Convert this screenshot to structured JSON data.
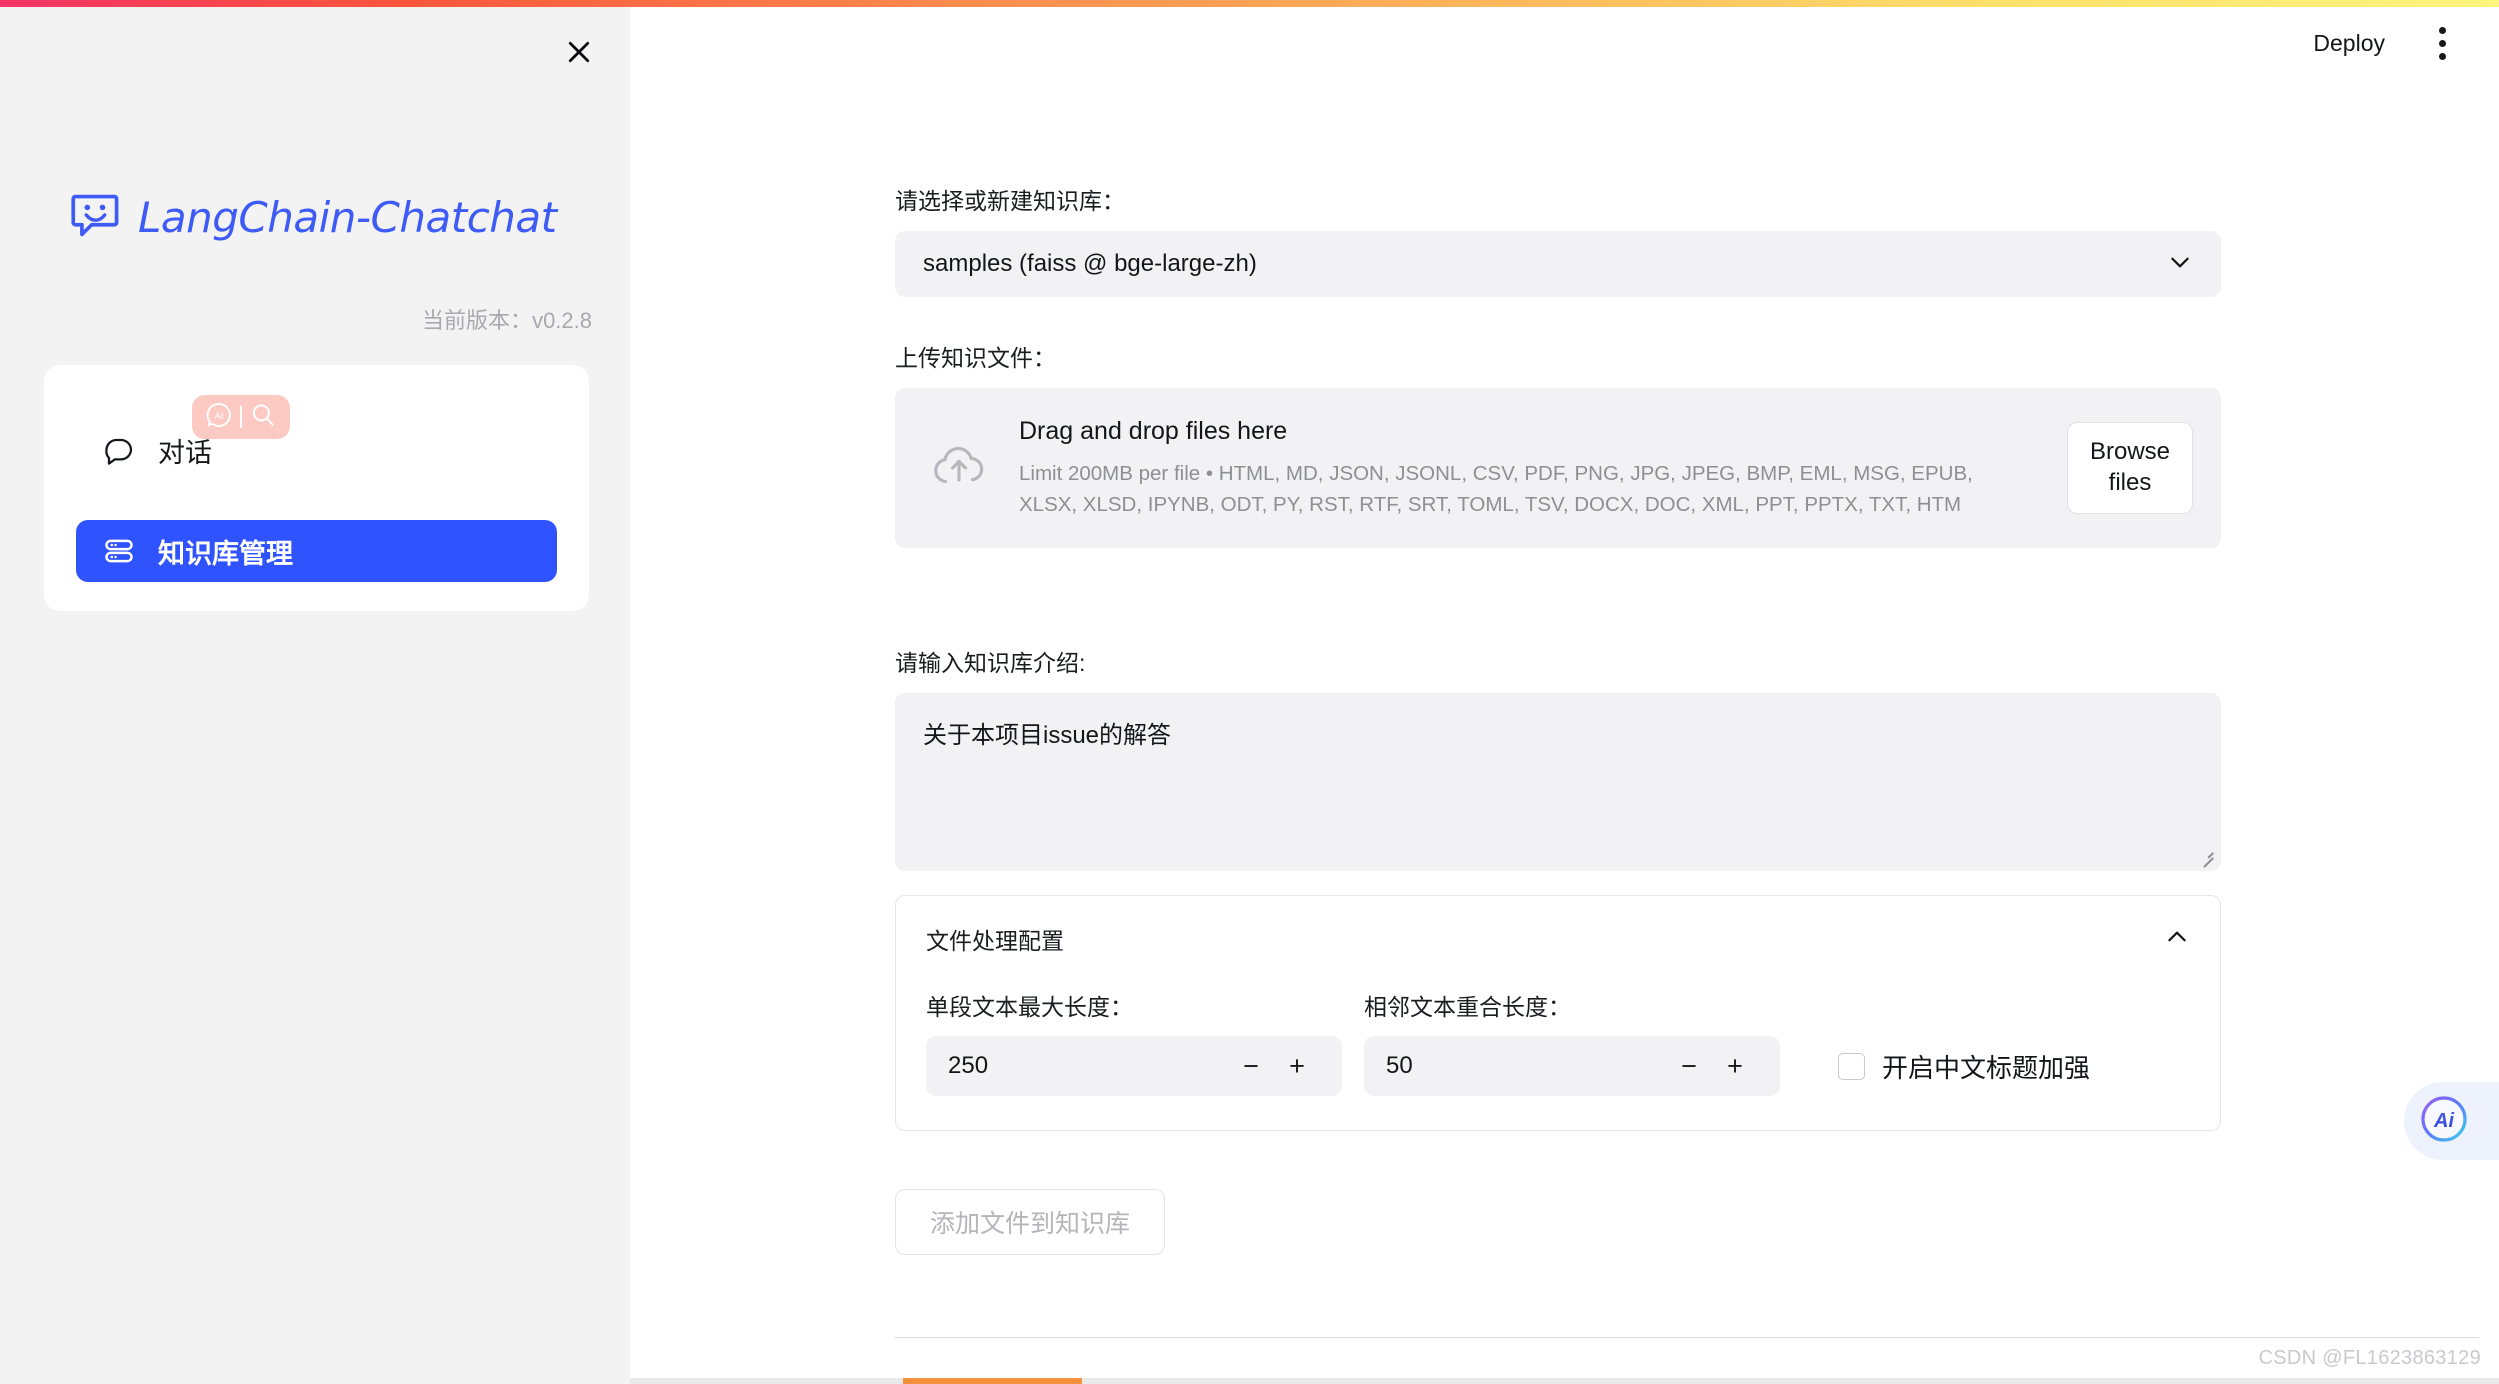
{
  "app": {
    "brand_name": "LangChain-Chatchat",
    "version_label": "当前版本：",
    "version_value": "v0.2.8"
  },
  "header": {
    "deploy_label": "Deploy",
    "menu_icon": "kebab-menu-icon"
  },
  "sidebar": {
    "close_icon": "close-icon",
    "items": [
      {
        "label": "对话",
        "icon": "chat-bubble-icon",
        "selected": false
      },
      {
        "label": "知识库管理",
        "icon": "database-icon",
        "selected": true
      }
    ],
    "badge": {
      "ai_icon": "ai-bubble-icon",
      "search_icon": "search-icon"
    }
  },
  "main": {
    "kb_select": {
      "label": "请选择或新建知识库：",
      "value": "samples (faiss @ bge-large-zh)",
      "chevron_icon": "chevron-down-icon"
    },
    "uploader": {
      "label": "上传知识文件：",
      "drag_title": "Drag and drop files here",
      "limit_text": "Limit 200MB per file • HTML, MD, JSON, JSONL, CSV, PDF, PNG, JPG, JPEG, BMP, EML, MSG, EPUB, XLSX, XLSD, IPYNB, ODT, PY, RST, RTF, SRT, TOML, TSV, DOCX, DOC, XML, PPT, PPTX, TXT, HTM",
      "browse_label": "Browse files",
      "upload_icon": "upload-cloud-icon"
    },
    "intro": {
      "label": "请输入知识库介绍:",
      "value": "关于本项目issue的解答",
      "placeholder": ""
    },
    "config": {
      "title": "文件处理配置",
      "collapse_icon": "chevron-up-icon",
      "chunk_size": {
        "label": "单段文本最大长度：",
        "value": "250",
        "minus_label": "−",
        "plus_label": "+"
      },
      "chunk_overlap": {
        "label": "相邻文本重合长度：",
        "value": "50",
        "minus_label": "−",
        "plus_label": "+"
      },
      "zh_title_enhance": {
        "label": "开启中文标题加强",
        "checked": false
      }
    },
    "add_files_button": "添加文件到知识库"
  },
  "floating": {
    "ai_button_label": "Ai"
  },
  "watermark": "CSDN @FL1623863129",
  "colors": {
    "brand_blue": "#3e5bf6",
    "nav_selected": "#2f54ff",
    "sidebar_bg": "#f4f3f4",
    "field_bg": "#f2f2f4",
    "badge_pink": "#fcc9c3",
    "progress_orange": "#f5903c"
  }
}
